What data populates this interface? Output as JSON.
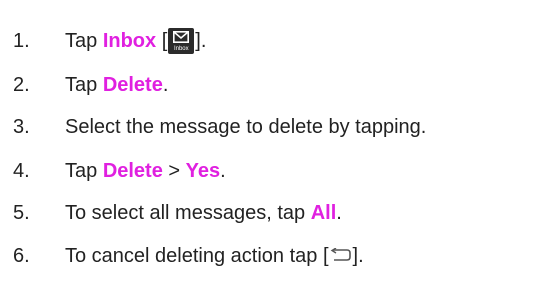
{
  "steps": [
    {
      "num": "1.",
      "before": "Tap ",
      "kw": "Inbox",
      "after_open": " [",
      "icon_label": "Inbox",
      "after_close": "]."
    },
    {
      "num": "2.",
      "before": "Tap ",
      "kw": "Delete",
      "after": "."
    },
    {
      "num": "3.",
      "text": "Select the message to delete by tapping."
    },
    {
      "num": "4.",
      "before": "Tap ",
      "kw": "Delete",
      "mid": " > ",
      "kw2": "Yes",
      "after": "."
    },
    {
      "num": "5.",
      "before": "To select all messages, tap ",
      "kw": "All",
      "after": "."
    },
    {
      "num": "6.",
      "before": "To cancel deleting action tap [",
      "after": "]."
    }
  ],
  "colors": {
    "keyword": "#e020e0",
    "text": "#222222",
    "icon_bg": "#2b2b2b"
  },
  "icons": {
    "inbox": "envelope-inbox-icon",
    "back": "back-arrow-icon"
  }
}
